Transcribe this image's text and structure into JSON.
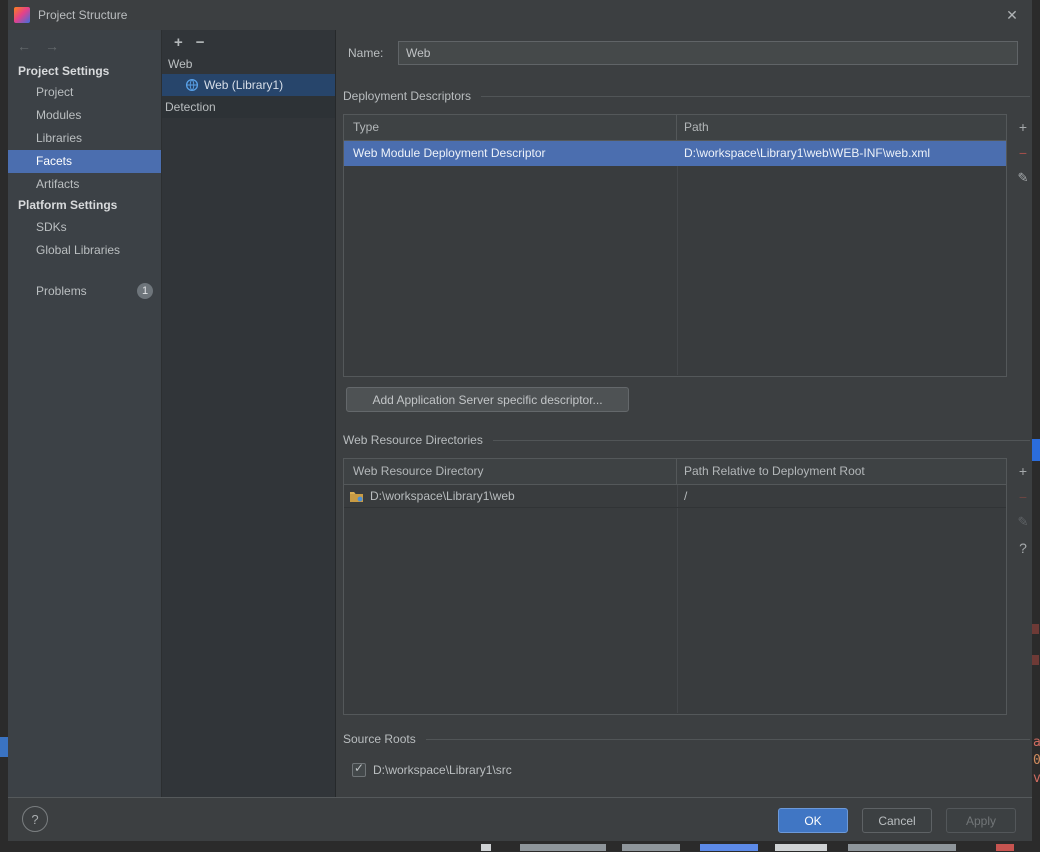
{
  "titlebar": {
    "title": "Project Structure"
  },
  "glyphs": {
    "back": "←",
    "forward": "→",
    "add": "+",
    "remove": "−",
    "edit": "✎",
    "help": "?",
    "close": "✕",
    "check": "✓"
  },
  "sidebar": {
    "sections": [
      {
        "header": "Project Settings",
        "items": [
          {
            "label": "Project"
          },
          {
            "label": "Modules"
          },
          {
            "label": "Libraries"
          },
          {
            "label": "Facets",
            "selected": true
          },
          {
            "label": "Artifacts"
          }
        ]
      },
      {
        "header": "Platform Settings",
        "items": [
          {
            "label": "SDKs"
          },
          {
            "label": "Global Libraries"
          }
        ]
      }
    ],
    "problems": {
      "label": "Problems",
      "badge": "1"
    }
  },
  "tree": {
    "group_label": "Web",
    "selected_item": "Web (Library1)",
    "detection_label": "Detection"
  },
  "form": {
    "name_label": "Name:",
    "name_value": "Web"
  },
  "deployment": {
    "title": "Deployment Descriptors",
    "columns": [
      "Type",
      "Path"
    ],
    "rows": [
      [
        "Web Module Deployment Descriptor",
        "D:\\workspace\\Library1\\web\\WEB-INF\\web.xml"
      ]
    ],
    "add_server_button": "Add Application Server specific descriptor..."
  },
  "resources": {
    "title": "Web Resource Directories",
    "columns": [
      "Web Resource Directory",
      "Path Relative to Deployment Root"
    ],
    "rows": [
      [
        "D:\\workspace\\Library1\\web",
        "/"
      ]
    ]
  },
  "source_roots": {
    "title": "Source Roots",
    "items": [
      {
        "label": "D:\\workspace\\Library1\\src",
        "checked": true
      }
    ]
  },
  "footer": {
    "ok": "OK",
    "cancel": "Cancel",
    "apply": "Apply"
  },
  "background": {
    "right_edge_letters": [
      "a",
      "0",
      "v"
    ]
  },
  "colors": {
    "dialog_bg": "#3c3f41",
    "selection_blue": "#4b6eaf",
    "tree_selection": "#27456b",
    "ok_blue": "#4076c4",
    "remove_red": "#a5504b"
  }
}
